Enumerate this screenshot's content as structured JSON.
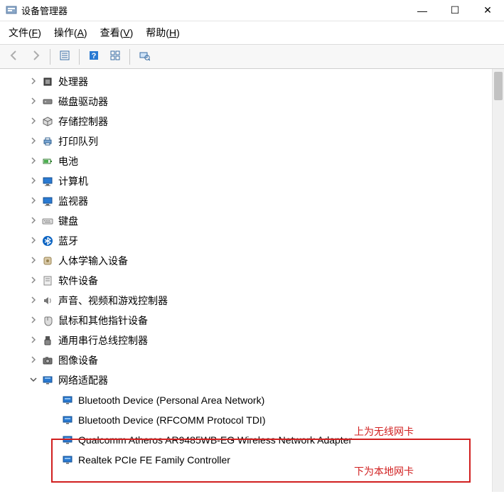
{
  "window": {
    "title": "设备管理器",
    "buttons": {
      "min": "—",
      "max": "☐",
      "close": "✕"
    }
  },
  "menu": {
    "file": {
      "label": "文件",
      "accel": "F"
    },
    "action": {
      "label": "操作",
      "accel": "A"
    },
    "view": {
      "label": "查看",
      "accel": "V"
    },
    "help": {
      "label": "帮助",
      "accel": "H"
    }
  },
  "toolbar_icons": {
    "back": "back-icon",
    "forward": "forward-icon",
    "details": "details-icon",
    "help": "help-icon",
    "small": "small-icon",
    "scan": "scan-icon"
  },
  "tree": {
    "nodes": [
      {
        "id": "cpu",
        "label": "处理器",
        "icon": "cpu-icon",
        "expanded": false
      },
      {
        "id": "disk",
        "label": "磁盘驱动器",
        "icon": "disk-icon",
        "expanded": false
      },
      {
        "id": "storage",
        "label": "存储控制器",
        "icon": "storage-icon",
        "expanded": false
      },
      {
        "id": "printq",
        "label": "打印队列",
        "icon": "printer-icon",
        "expanded": false
      },
      {
        "id": "battery",
        "label": "电池",
        "icon": "battery-icon",
        "expanded": false
      },
      {
        "id": "computer",
        "label": "计算机",
        "icon": "monitor-icon",
        "expanded": false
      },
      {
        "id": "monitor",
        "label": "监视器",
        "icon": "monitor-icon",
        "expanded": false
      },
      {
        "id": "keyboard",
        "label": "键盘",
        "icon": "keyboard-icon",
        "expanded": false
      },
      {
        "id": "bluetooth",
        "label": "蓝牙",
        "icon": "bluetooth-icon",
        "expanded": false
      },
      {
        "id": "hid",
        "label": "人体学输入设备",
        "icon": "hid-icon",
        "expanded": false
      },
      {
        "id": "software",
        "label": "软件设备",
        "icon": "software-icon",
        "expanded": false
      },
      {
        "id": "sound",
        "label": "声音、视频和游戏控制器",
        "icon": "speaker-icon",
        "expanded": false
      },
      {
        "id": "mouse",
        "label": "鼠标和其他指针设备",
        "icon": "mouse-icon",
        "expanded": false
      },
      {
        "id": "usb",
        "label": "通用串行总线控制器",
        "icon": "usb-icon",
        "expanded": false
      },
      {
        "id": "imaging",
        "label": "图像设备",
        "icon": "camera-icon",
        "expanded": false
      },
      {
        "id": "network",
        "label": "网络适配器",
        "icon": "network-icon",
        "expanded": true,
        "children": [
          {
            "id": "net-bt-pan",
            "label": "Bluetooth Device (Personal Area Network)"
          },
          {
            "id": "net-bt-rf",
            "label": "Bluetooth Device (RFCOMM Protocol TDI)"
          },
          {
            "id": "net-wifi",
            "label": "Qualcomm Atheros AR9485WB-EG Wireless Network Adapter"
          },
          {
            "id": "net-lan",
            "label": "Realtek PCIe FE Family Controller"
          }
        ]
      }
    ]
  },
  "annotations": {
    "upper_label": "上为无线网卡",
    "lower_label": "下为本地网卡"
  }
}
